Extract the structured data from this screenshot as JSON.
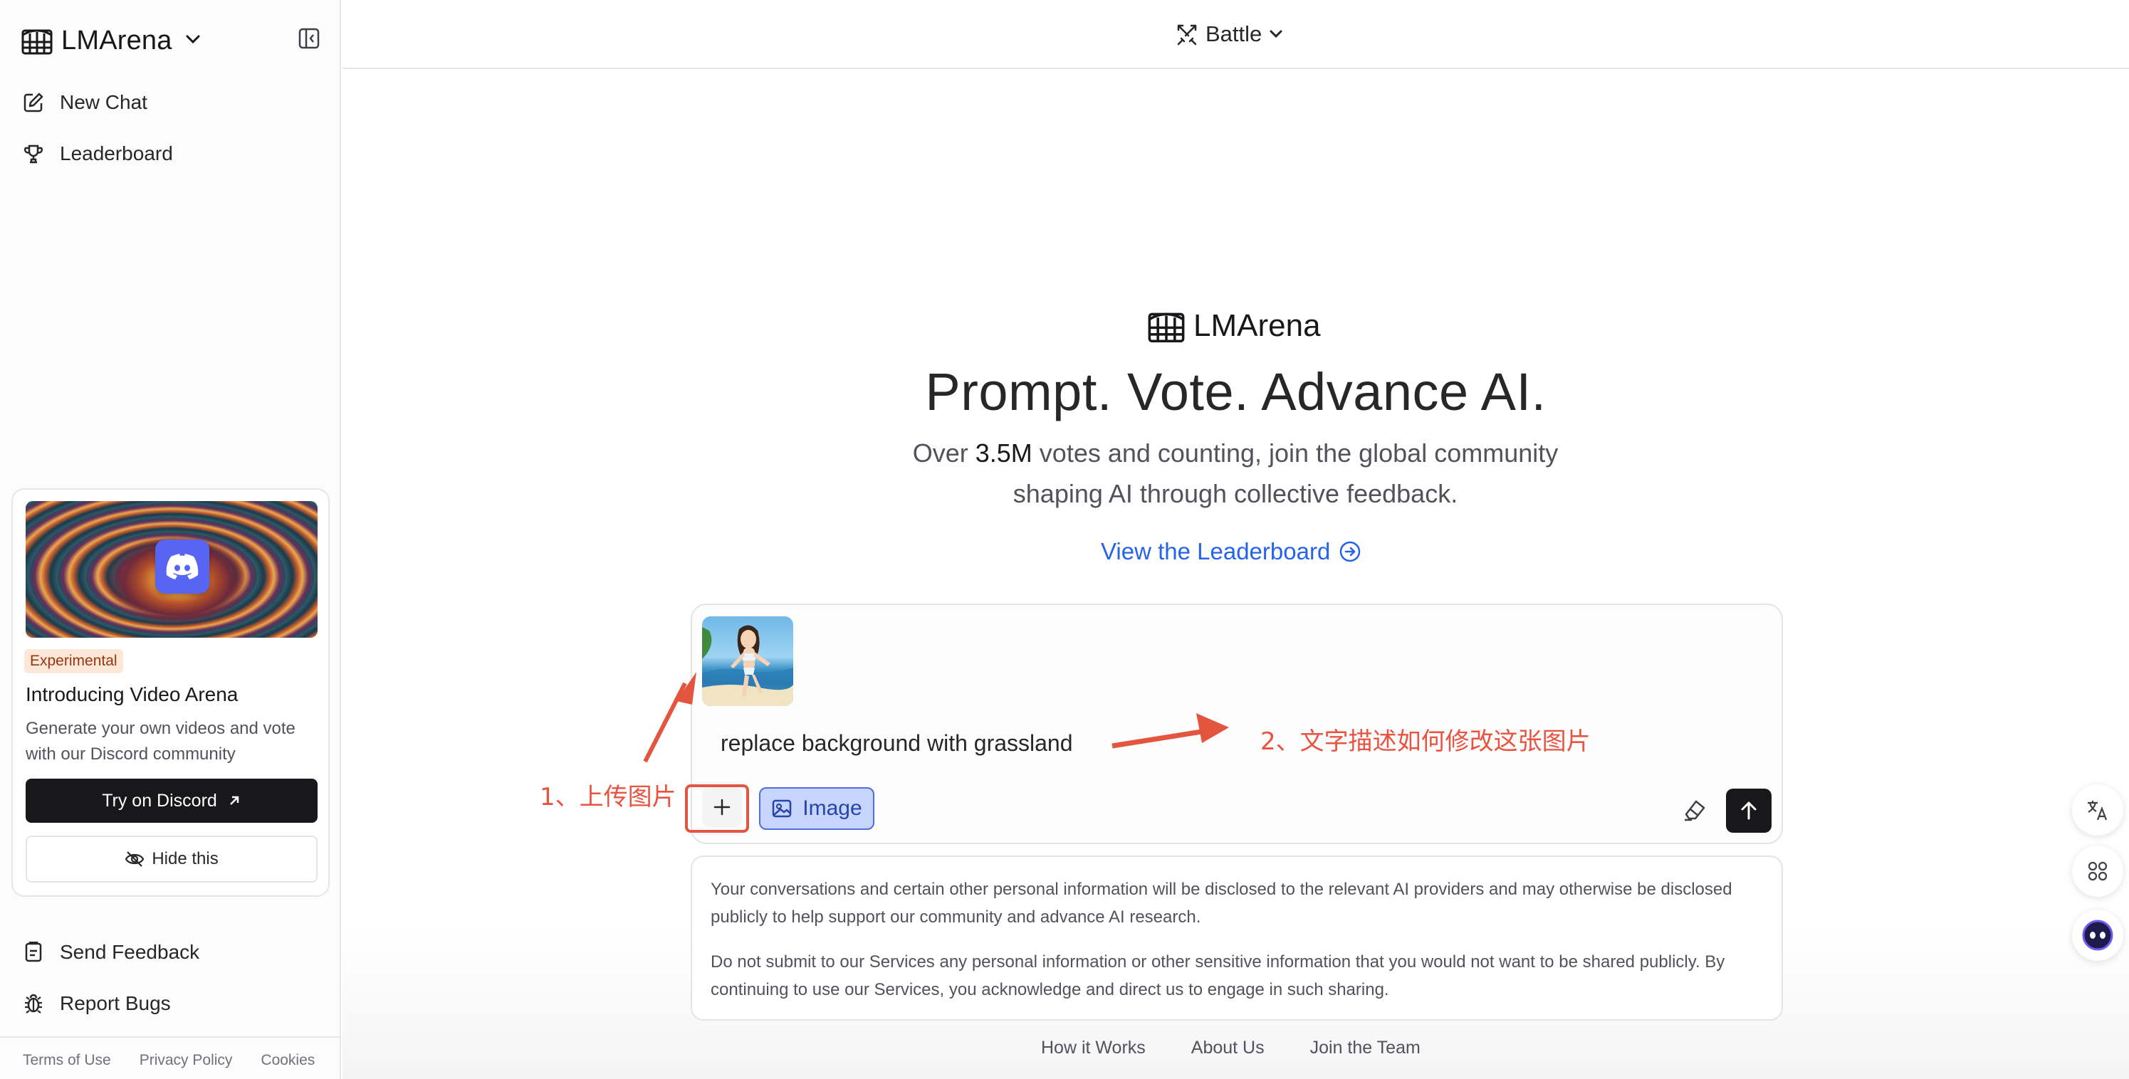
{
  "sidebar": {
    "brand": "LMArena",
    "nav": [
      {
        "label": "New Chat",
        "icon": "edit-icon"
      },
      {
        "label": "Leaderboard",
        "icon": "trophy-icon"
      }
    ],
    "promo": {
      "badge": "Experimental",
      "title": "Introducing Video Arena",
      "description": "Generate your own videos and vote with our Discord community",
      "cta": "Try on Discord",
      "hide": "Hide this"
    },
    "bottom_nav": [
      {
        "label": "Send Feedback",
        "icon": "feedback-icon"
      },
      {
        "label": "Report Bugs",
        "icon": "bug-icon"
      }
    ],
    "footer_links": [
      "Terms of Use",
      "Privacy Policy",
      "Cookies"
    ]
  },
  "topbar": {
    "mode": "Battle"
  },
  "hero": {
    "brand": "LMArena",
    "title": "Prompt. Vote. Advance AI.",
    "subtitle_pre": "Over ",
    "subtitle_stat": "3.5M",
    "subtitle_post": " votes and counting, join the global community shaping AI through collective feedback.",
    "link": "View the Leaderboard"
  },
  "composer": {
    "prompt": "replace background with grassland",
    "image_chip": "Image",
    "add_symbol": "+"
  },
  "notice": {
    "p1": "Your conversations and certain other personal information will be disclosed to the relevant AI providers and may otherwise be disclosed publicly to help support our community and advance AI research.",
    "p2": "Do not submit to our Services any personal information or other sensitive information that you would not want to be shared publicly. By continuing to use our Services, you acknowledge and direct us to engage in such sharing."
  },
  "footer_links": [
    "How it Works",
    "About Us",
    "Join the Team"
  ],
  "annotations": {
    "step1": "1、上传图片",
    "step2": "2、文字描述如何修改这张图片"
  },
  "colors": {
    "accent_link": "#2563eb",
    "annotation": "#e9533f",
    "image_chip_bg": "#c7d4fb",
    "dark_button": "#18181b"
  }
}
